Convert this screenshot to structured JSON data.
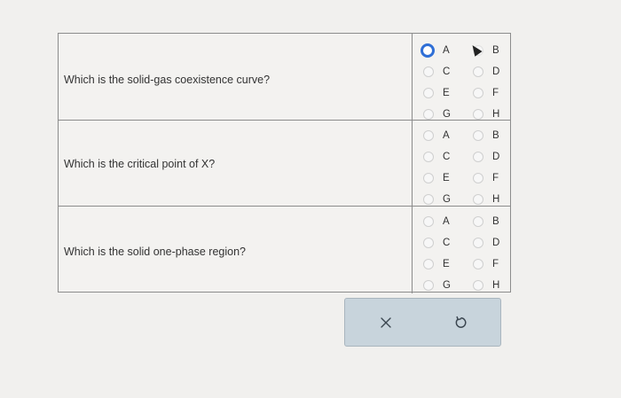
{
  "questions": [
    {
      "text": "Which is the solid-gas coexistence curve?",
      "options_left": [
        "A",
        "C",
        "E",
        "G"
      ],
      "options_right": [
        "B",
        "D",
        "F",
        "H"
      ]
    },
    {
      "text": "Which is the critical point of X?",
      "options_left": [
        "A",
        "C",
        "E",
        "G"
      ],
      "options_right": [
        "B",
        "D",
        "F",
        "H"
      ]
    },
    {
      "text": "Which is the solid one-phase region?",
      "options_left": [
        "A",
        "C",
        "E",
        "G"
      ],
      "options_right": [
        "B",
        "D",
        "F",
        "H"
      ]
    }
  ],
  "toolbar": {
    "clear_icon": "close-icon",
    "reset_icon": "undo-icon"
  },
  "colors": {
    "background": "#f1f0ee",
    "focus_ring": "#2f6fd6",
    "toolbar_bg": "#c8d4dc"
  }
}
